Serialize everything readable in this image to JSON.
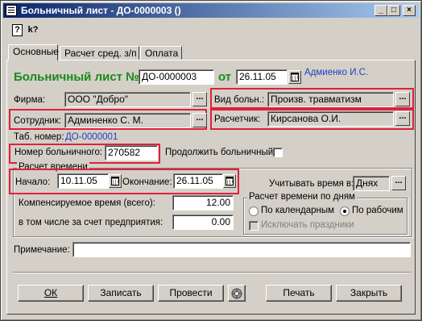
{
  "window": {
    "title": "Больничный лист - ДО-0000003 ()",
    "controls": {
      "minimize": "_",
      "maximize": "□",
      "close": "×"
    }
  },
  "toolbar": {
    "help_icon": "?",
    "whats_this_icon": "k?"
  },
  "tabs": [
    "Основные",
    "Расчет сред. з/п",
    "Оплата"
  ],
  "header": {
    "title": "Больничный лист №",
    "number": "ДО-0000003",
    "date_label": "от",
    "date": "26.11.05",
    "author": "Адмиенко И.С."
  },
  "form": {
    "firm_label": "Фирма:",
    "firm_value": "ООО \"Добро\"",
    "illness_type_label": "Вид больн.:",
    "illness_type_value": "Произв. травматизм",
    "employee_label": "Сотрудник:",
    "employee_value": "Админенко С. М.",
    "calculator_label": "Расчетчик:",
    "calculator_value": "Кирсанова О.И.",
    "tab_number_label": "Таб. номер:",
    "tab_number_value": "ДО-0000001",
    "sick_number_label": "Номер больничного:",
    "sick_number_value": "270582",
    "continue_label": "Продолжить больничный",
    "time_group_title": "Расчет времени",
    "start_label": "Начало:",
    "start_value": "10.11.05",
    "end_label": "Окончание:",
    "end_value": "26.11.05",
    "account_time_label": "Учитывать время в:",
    "account_time_value": "Днях",
    "compensated_label": "Компенсируемое время (всего):",
    "compensated_value": "12.00",
    "employer_label": "в том числе за счет предприятия:",
    "employer_value": "0.00",
    "days_group_title": "Расчет времени по дням",
    "calendar_label": "По календарным",
    "working_label": "По рабочим",
    "exclude_holidays_label": "Исключать праздники",
    "note_label": "Примечание:",
    "note_value": ""
  },
  "buttons": {
    "ok": "ОК",
    "save": "Записать",
    "post": "Провести",
    "print": "Печать",
    "close": "Закрыть"
  },
  "colors": {
    "highlight": "#e0203a",
    "title_green": "#1a8a1a",
    "link_blue": "#1f3ec2"
  }
}
